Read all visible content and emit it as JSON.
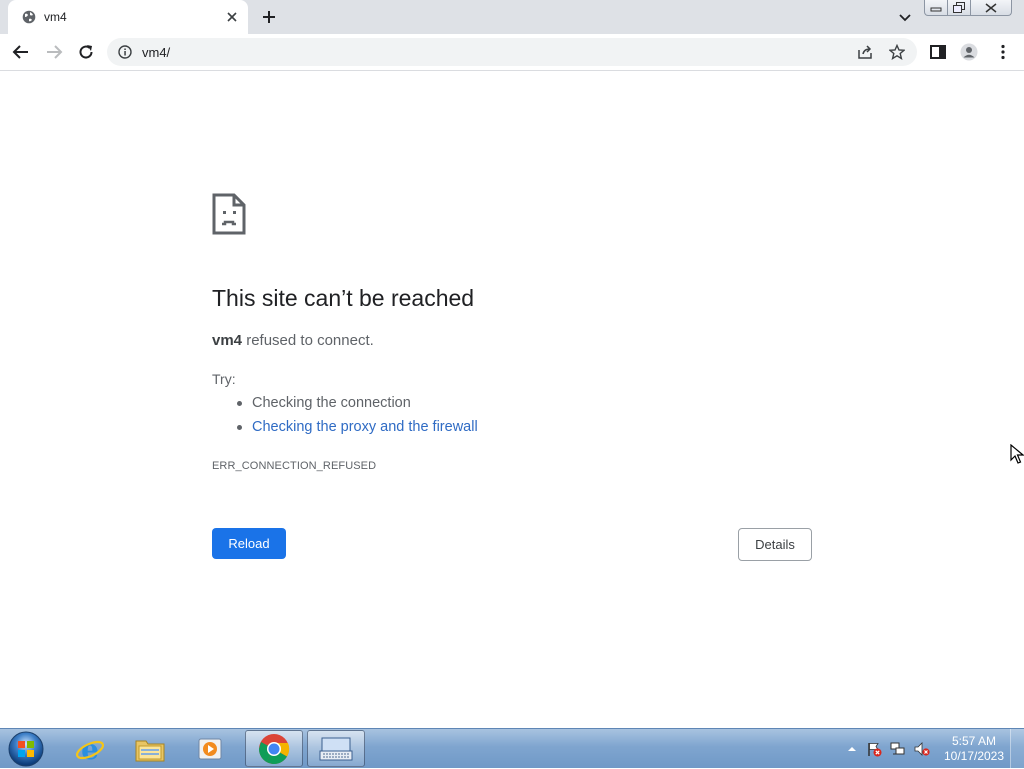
{
  "browser": {
    "tab": {
      "title": "vm4"
    },
    "address": {
      "url": "vm4/"
    }
  },
  "error": {
    "heading": "This site can’t be reached",
    "host": "vm4",
    "summary_rest": " refused to connect.",
    "try_label": "Try:",
    "suggestions": [
      "Checking the connection",
      "Checking the proxy and the firewall"
    ],
    "code": "ERR_CONNECTION_REFUSED",
    "reload_label": "Reload",
    "details_label": "Details"
  },
  "taskbar": {
    "apps": [
      "internet-explorer",
      "windows-explorer",
      "media-player",
      "chrome",
      "keyboard-app"
    ],
    "clock": {
      "time": "5:57 AM",
      "date": "10/17/2023"
    }
  },
  "colors": {
    "accent": "#1a73e8",
    "link": "#2f6bc4"
  }
}
